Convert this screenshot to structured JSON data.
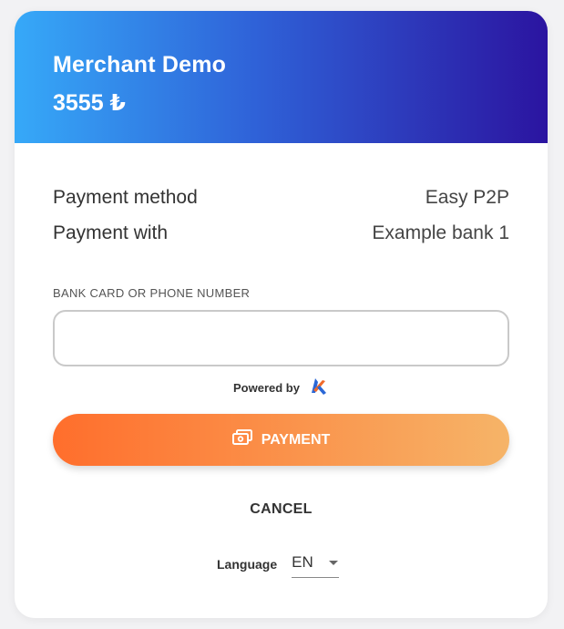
{
  "header": {
    "merchant_name": "Merchant Demo",
    "amount": "3555 ₺"
  },
  "details": [
    {
      "label": "Payment method",
      "value": "Easy P2P"
    },
    {
      "label": "Payment with",
      "value": "Example bank 1"
    }
  ],
  "form": {
    "field_label": "BANK CARD OR PHONE NUMBER",
    "field_value": "",
    "field_placeholder": ""
  },
  "powered": {
    "label": "Powered by",
    "logo_icon": "brand-logo-icon"
  },
  "actions": {
    "pay_label": "PAYMENT",
    "pay_icon": "money-icon",
    "cancel_label": "CANCEL"
  },
  "language": {
    "label": "Language",
    "selected": "EN"
  },
  "colors": {
    "header_start": "#36a9f8",
    "header_end": "#2b14a0",
    "button_start": "#ff6e2c",
    "button_end": "#f6b468"
  }
}
